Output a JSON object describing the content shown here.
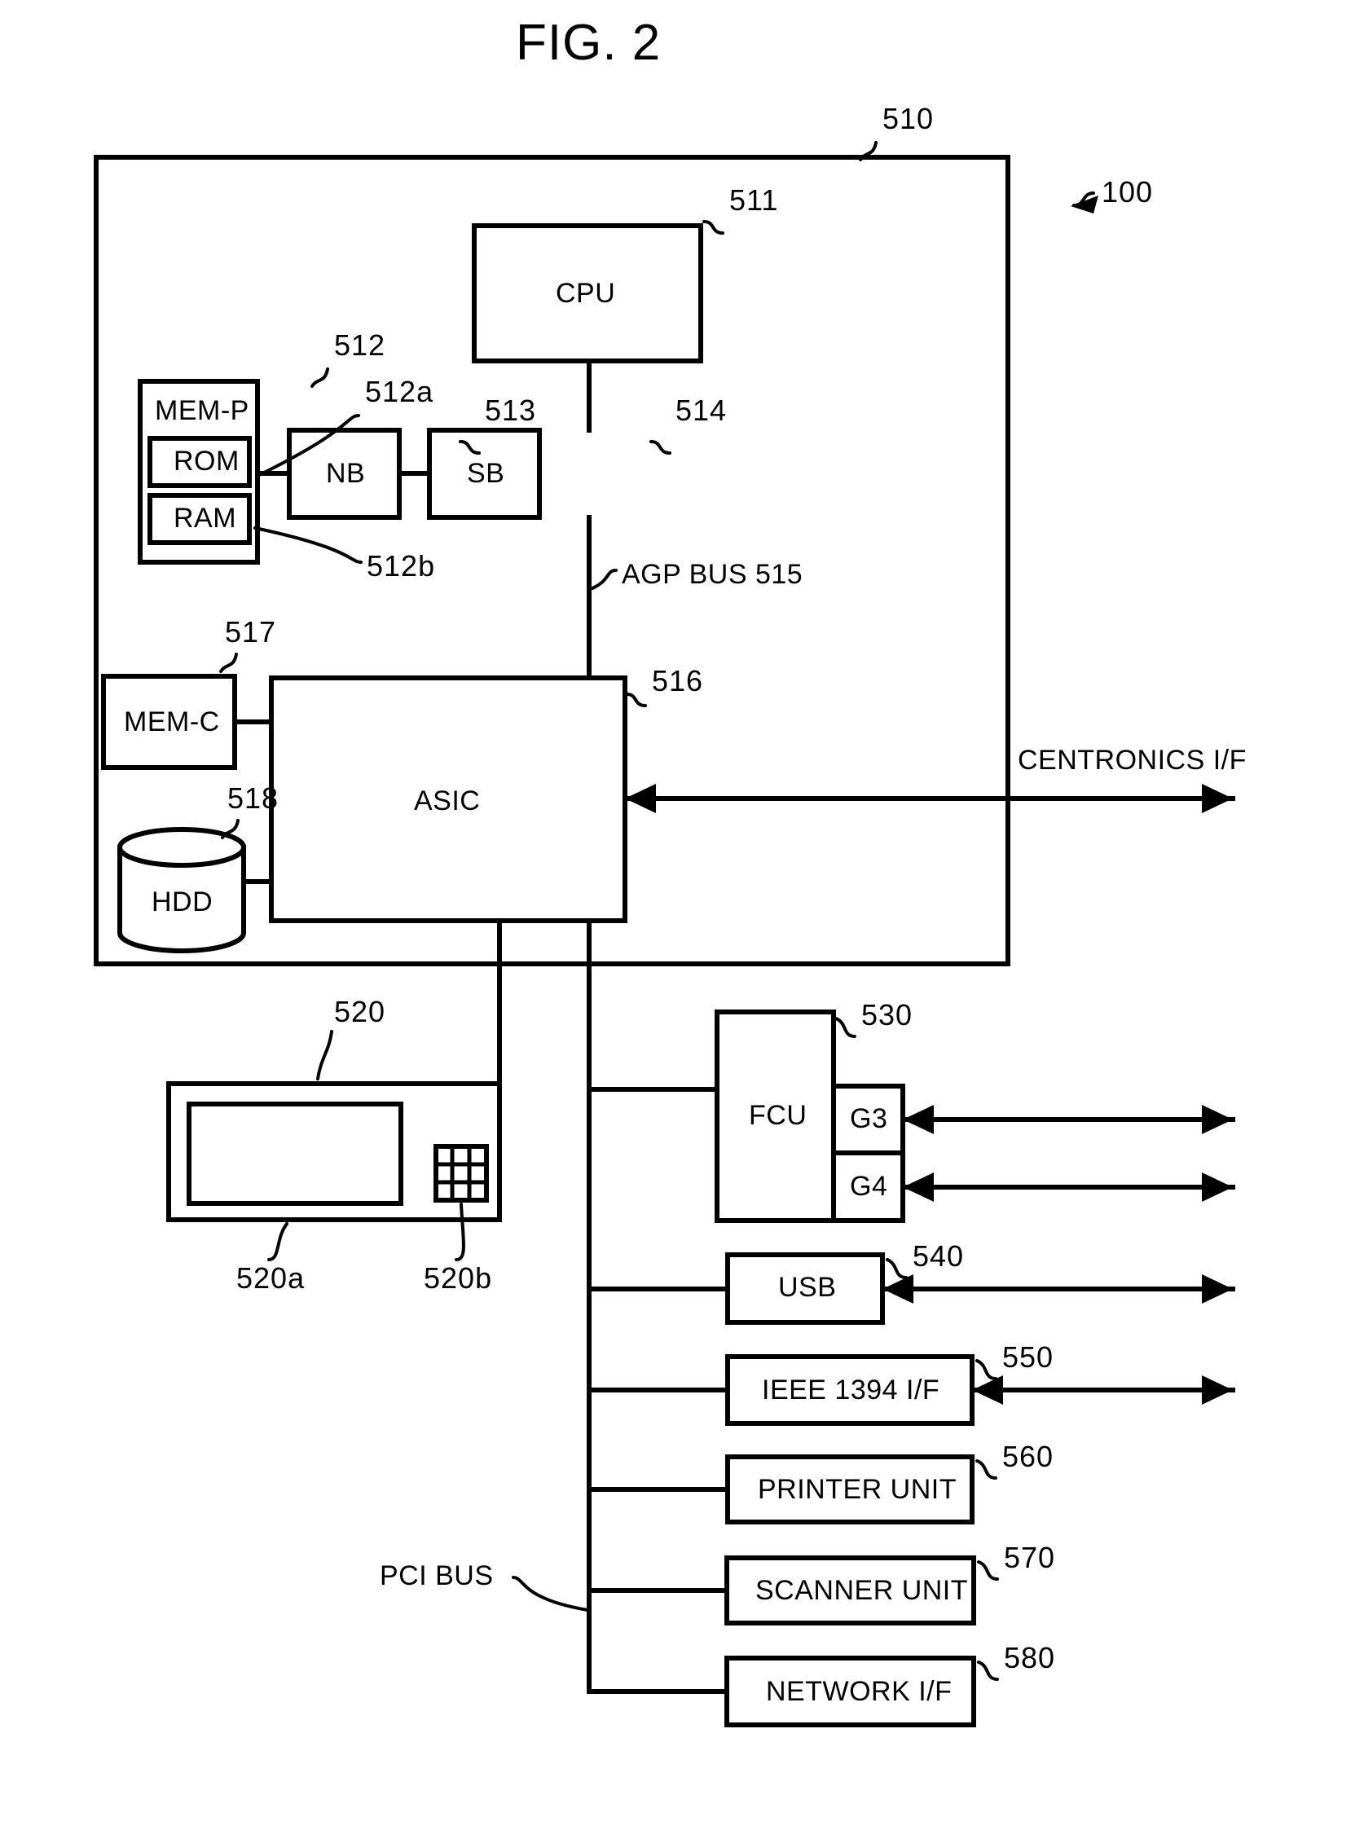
{
  "figure": {
    "title": "FIG. 2",
    "system_ref": "100",
    "controller_ref": "510"
  },
  "blocks": {
    "cpu": {
      "label": "CPU",
      "ref": "511"
    },
    "mem_p": {
      "label": "MEM-P",
      "ref": "512"
    },
    "rom": {
      "label": "ROM",
      "ref": "512a"
    },
    "ram": {
      "label": "RAM",
      "ref": "512b"
    },
    "nb": {
      "label": "NB",
      "ref": "513"
    },
    "sb": {
      "label": "SB",
      "ref": "514"
    },
    "asic": {
      "label": "ASIC",
      "ref": "516"
    },
    "mem_c": {
      "label": "MEM-C",
      "ref": "517"
    },
    "hdd": {
      "label": "HDD",
      "ref": "518"
    },
    "op_panel": {
      "label": "",
      "ref": "520"
    },
    "op_display": {
      "label": "",
      "ref": "520a"
    },
    "op_keypad": {
      "label": "",
      "ref": "520b"
    },
    "fcu": {
      "label": "FCU",
      "ref": "530"
    },
    "g3": {
      "label": "G3",
      "ref": ""
    },
    "g4": {
      "label": "G4",
      "ref": ""
    },
    "usb": {
      "label": "USB",
      "ref": "540"
    },
    "ieee1394": {
      "label": "IEEE 1394 I/F",
      "ref": "550"
    },
    "printer": {
      "label": "PRINTER UNIT",
      "ref": "560"
    },
    "scanner": {
      "label": "SCANNER UNIT",
      "ref": "570"
    },
    "network": {
      "label": "NETWORK I/F",
      "ref": "580"
    }
  },
  "buses": {
    "agp": "AGP BUS 515",
    "pci": "PCI BUS"
  },
  "interfaces": {
    "centronics": "CENTRONICS I/F"
  },
  "style": {
    "ink": "#000000",
    "paper": "#ffffff"
  }
}
